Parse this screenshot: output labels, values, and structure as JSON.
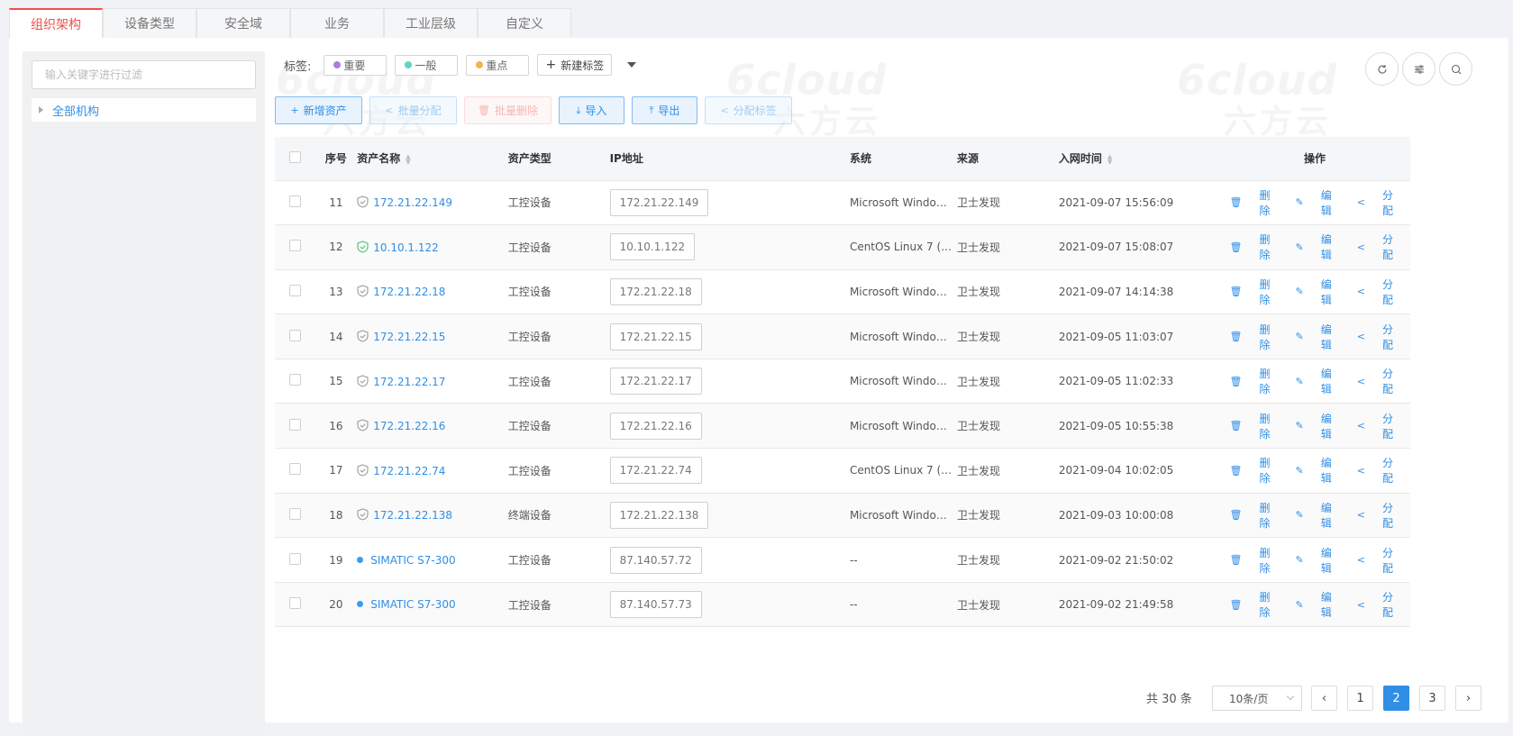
{
  "tabs": [
    "组织架构",
    "设备类型",
    "安全域",
    "业务",
    "工业层级",
    "自定义"
  ],
  "filter": {
    "placeholder": "输入关键字进行过滤"
  },
  "tree": {
    "root": "全部机构"
  },
  "tags": {
    "label": "标签:",
    "items": [
      {
        "label": "重要",
        "color": "#b07ae8"
      },
      {
        "label": "一般",
        "color": "#5fd6c4"
      },
      {
        "label": "重点",
        "color": "#f0b44c"
      }
    ],
    "new_label": "新建标签"
  },
  "toolbar": {
    "add": "新增资产",
    "batch_assign": "批量分配",
    "batch_delete": "批量删除",
    "import": "导入",
    "export": "导出",
    "assign_tag": "分配标签"
  },
  "watermark": {
    "en": "6cloud",
    "cn": "六方云"
  },
  "table": {
    "headers": [
      "序号",
      "资产名称",
      "资产类型",
      "IP地址",
      "系统",
      "来源",
      "入网时间",
      "操作"
    ],
    "rows": [
      {
        "no": "11",
        "name": "172.21.22.149",
        "icon": "shield-gray-icon",
        "type": "工控设备",
        "ip": "172.21.22.149",
        "os": "Microsoft Windo…",
        "src": "卫士发现",
        "time": "2021-09-07 15:56:09"
      },
      {
        "no": "12",
        "name": "10.10.1.122",
        "icon": "shield-green-icon",
        "type": "工控设备",
        "ip": "10.10.1.122",
        "os": "CentOS Linux 7 (…",
        "src": "卫士发现",
        "time": "2021-09-07 15:08:07"
      },
      {
        "no": "13",
        "name": "172.21.22.18",
        "icon": "shield-gray-icon",
        "type": "工控设备",
        "ip": "172.21.22.18",
        "os": "Microsoft Windo…",
        "src": "卫士发现",
        "time": "2021-09-07 14:14:38"
      },
      {
        "no": "14",
        "name": "172.21.22.15",
        "icon": "shield-gray-icon",
        "type": "工控设备",
        "ip": "172.21.22.15",
        "os": "Microsoft Windo…",
        "src": "卫士发现",
        "time": "2021-09-05 11:03:07"
      },
      {
        "no": "15",
        "name": "172.21.22.17",
        "icon": "shield-gray-icon",
        "type": "工控设备",
        "ip": "172.21.22.17",
        "os": "Microsoft Windo…",
        "src": "卫士发现",
        "time": "2021-09-05 11:02:33"
      },
      {
        "no": "16",
        "name": "172.21.22.16",
        "icon": "shield-gray-icon",
        "type": "工控设备",
        "ip": "172.21.22.16",
        "os": "Microsoft Windo…",
        "src": "卫士发现",
        "time": "2021-09-05 10:55:38"
      },
      {
        "no": "17",
        "name": "172.21.22.74",
        "icon": "shield-gray-icon",
        "type": "工控设备",
        "ip": "172.21.22.74",
        "os": "CentOS Linux 7 (…",
        "src": "卫士发现",
        "time": "2021-09-04 10:02:05"
      },
      {
        "no": "18",
        "name": "172.21.22.138",
        "icon": "shield-gray-icon",
        "type": "终端设备",
        "ip": "172.21.22.138",
        "os": "Microsoft Windo…",
        "src": "卫士发现",
        "time": "2021-09-03 10:00:08"
      },
      {
        "no": "19",
        "name": "SIMATIC S7-300",
        "icon": "blue-dot-icon",
        "type": "工控设备",
        "ip": "87.140.57.72",
        "os": "--",
        "src": "卫士发现",
        "time": "2021-09-02 21:50:02"
      },
      {
        "no": "20",
        "name": "SIMATIC S7-300",
        "icon": "blue-dot-icon",
        "type": "工控设备",
        "ip": "87.140.57.73",
        "os": "--",
        "src": "卫士发现",
        "time": "2021-09-02 21:49:58"
      }
    ],
    "actions": {
      "delete": "删 除",
      "edit": "编辑",
      "assign": "分配"
    }
  },
  "pagination": {
    "total": "共 30 条",
    "page_size": "10条/页",
    "pages": [
      "1",
      "2",
      "3"
    ],
    "current": "2"
  }
}
